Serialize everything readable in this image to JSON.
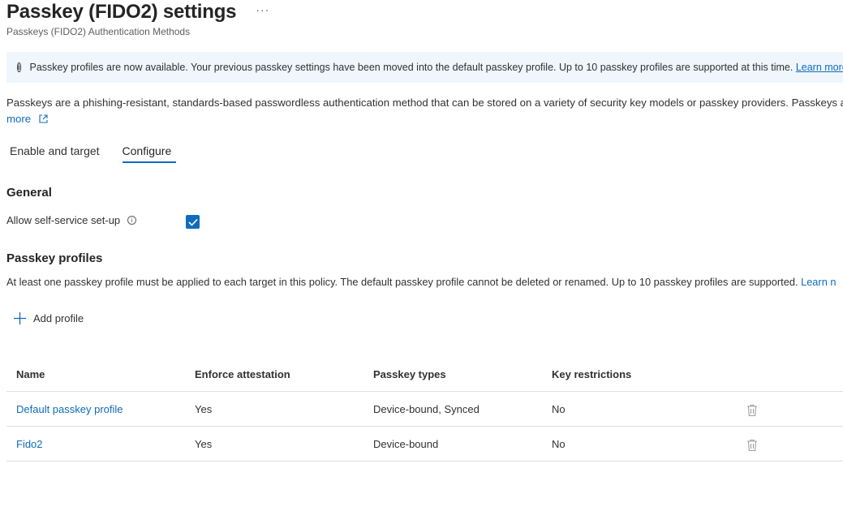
{
  "header": {
    "title": "Passkey (FIDO2) settings",
    "more": "···",
    "subtitle": "Passkeys (FIDO2) Authentication Methods"
  },
  "banner": {
    "text": "Passkey profiles are now available. Your previous passkey settings have been moved into the default passkey profile. Up to 10 passkey profiles are supported at this time.",
    "link": "Learn more"
  },
  "description": {
    "text": "Passkeys are a phishing-resistant, standards-based passwordless authentication method that can be stored on a variety of security key models or passkey providers. Passkeys are not",
    "link_tail": "more"
  },
  "tabs": [
    {
      "label": "Enable and target",
      "active": false
    },
    {
      "label": "Configure",
      "active": true
    }
  ],
  "general": {
    "title": "General",
    "self_service_label": "Allow self-service set-up",
    "self_service_checked": true
  },
  "profiles": {
    "title": "Passkey profiles",
    "description": "At least one passkey profile must be applied to each target in this policy. The default passkey profile cannot be deleted or renamed. Up to 10 passkey profiles are supported.",
    "description_link": "Learn n",
    "add_label": "Add profile",
    "columns": [
      "Name",
      "Enforce attestation",
      "Passkey types",
      "Key restrictions"
    ],
    "rows": [
      {
        "name": "Default passkey profile",
        "attestation": "Yes",
        "types": "Device-bound, Synced",
        "restrictions": "No"
      },
      {
        "name": "Fido2",
        "attestation": "Yes",
        "types": "Device-bound",
        "restrictions": "No"
      }
    ]
  },
  "colors": {
    "accent": "#0f6cbd",
    "banner_bg": "#eff6fc",
    "text": "#323130",
    "border": "#e1dfdd"
  },
  "icons": {
    "info": "info-circle-icon",
    "external": "external-link-icon",
    "plus": "plus-icon",
    "check": "checkmark-icon",
    "delete": "trash-icon"
  }
}
